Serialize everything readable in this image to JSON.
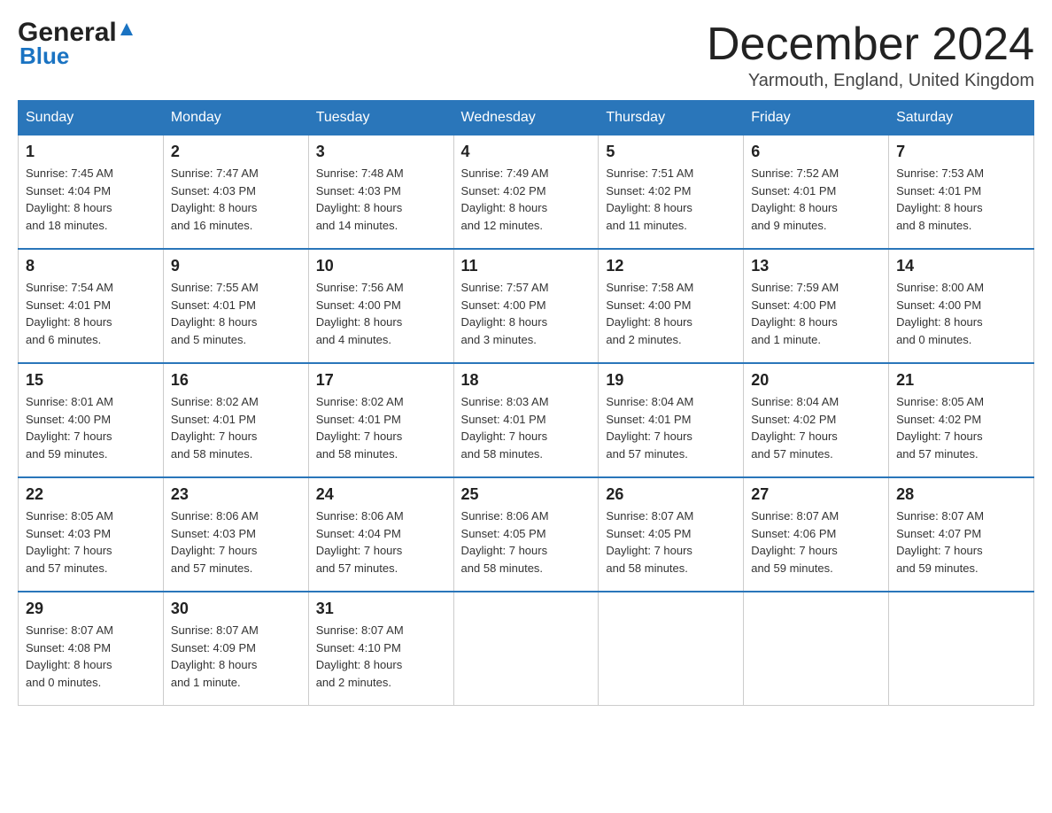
{
  "header": {
    "logo_general": "General",
    "logo_blue": "Blue",
    "month_title": "December 2024",
    "subtitle": "Yarmouth, England, United Kingdom"
  },
  "days_of_week": [
    "Sunday",
    "Monday",
    "Tuesday",
    "Wednesday",
    "Thursday",
    "Friday",
    "Saturday"
  ],
  "weeks": [
    [
      {
        "day": "1",
        "sunrise": "7:45 AM",
        "sunset": "4:04 PM",
        "daylight": "8 hours and 18 minutes."
      },
      {
        "day": "2",
        "sunrise": "7:47 AM",
        "sunset": "4:03 PM",
        "daylight": "8 hours and 16 minutes."
      },
      {
        "day": "3",
        "sunrise": "7:48 AM",
        "sunset": "4:03 PM",
        "daylight": "8 hours and 14 minutes."
      },
      {
        "day": "4",
        "sunrise": "7:49 AM",
        "sunset": "4:02 PM",
        "daylight": "8 hours and 12 minutes."
      },
      {
        "day": "5",
        "sunrise": "7:51 AM",
        "sunset": "4:02 PM",
        "daylight": "8 hours and 11 minutes."
      },
      {
        "day": "6",
        "sunrise": "7:52 AM",
        "sunset": "4:01 PM",
        "daylight": "8 hours and 9 minutes."
      },
      {
        "day": "7",
        "sunrise": "7:53 AM",
        "sunset": "4:01 PM",
        "daylight": "8 hours and 8 minutes."
      }
    ],
    [
      {
        "day": "8",
        "sunrise": "7:54 AM",
        "sunset": "4:01 PM",
        "daylight": "8 hours and 6 minutes."
      },
      {
        "day": "9",
        "sunrise": "7:55 AM",
        "sunset": "4:01 PM",
        "daylight": "8 hours and 5 minutes."
      },
      {
        "day": "10",
        "sunrise": "7:56 AM",
        "sunset": "4:00 PM",
        "daylight": "8 hours and 4 minutes."
      },
      {
        "day": "11",
        "sunrise": "7:57 AM",
        "sunset": "4:00 PM",
        "daylight": "8 hours and 3 minutes."
      },
      {
        "day": "12",
        "sunrise": "7:58 AM",
        "sunset": "4:00 PM",
        "daylight": "8 hours and 2 minutes."
      },
      {
        "day": "13",
        "sunrise": "7:59 AM",
        "sunset": "4:00 PM",
        "daylight": "8 hours and 1 minute."
      },
      {
        "day": "14",
        "sunrise": "8:00 AM",
        "sunset": "4:00 PM",
        "daylight": "8 hours and 0 minutes."
      }
    ],
    [
      {
        "day": "15",
        "sunrise": "8:01 AM",
        "sunset": "4:00 PM",
        "daylight": "7 hours and 59 minutes."
      },
      {
        "day": "16",
        "sunrise": "8:02 AM",
        "sunset": "4:01 PM",
        "daylight": "7 hours and 58 minutes."
      },
      {
        "day": "17",
        "sunrise": "8:02 AM",
        "sunset": "4:01 PM",
        "daylight": "7 hours and 58 minutes."
      },
      {
        "day": "18",
        "sunrise": "8:03 AM",
        "sunset": "4:01 PM",
        "daylight": "7 hours and 58 minutes."
      },
      {
        "day": "19",
        "sunrise": "8:04 AM",
        "sunset": "4:01 PM",
        "daylight": "7 hours and 57 minutes."
      },
      {
        "day": "20",
        "sunrise": "8:04 AM",
        "sunset": "4:02 PM",
        "daylight": "7 hours and 57 minutes."
      },
      {
        "day": "21",
        "sunrise": "8:05 AM",
        "sunset": "4:02 PM",
        "daylight": "7 hours and 57 minutes."
      }
    ],
    [
      {
        "day": "22",
        "sunrise": "8:05 AM",
        "sunset": "4:03 PM",
        "daylight": "7 hours and 57 minutes."
      },
      {
        "day": "23",
        "sunrise": "8:06 AM",
        "sunset": "4:03 PM",
        "daylight": "7 hours and 57 minutes."
      },
      {
        "day": "24",
        "sunrise": "8:06 AM",
        "sunset": "4:04 PM",
        "daylight": "7 hours and 57 minutes."
      },
      {
        "day": "25",
        "sunrise": "8:06 AM",
        "sunset": "4:05 PM",
        "daylight": "7 hours and 58 minutes."
      },
      {
        "day": "26",
        "sunrise": "8:07 AM",
        "sunset": "4:05 PM",
        "daylight": "7 hours and 58 minutes."
      },
      {
        "day": "27",
        "sunrise": "8:07 AM",
        "sunset": "4:06 PM",
        "daylight": "7 hours and 59 minutes."
      },
      {
        "day": "28",
        "sunrise": "8:07 AM",
        "sunset": "4:07 PM",
        "daylight": "7 hours and 59 minutes."
      }
    ],
    [
      {
        "day": "29",
        "sunrise": "8:07 AM",
        "sunset": "4:08 PM",
        "daylight": "8 hours and 0 minutes."
      },
      {
        "day": "30",
        "sunrise": "8:07 AM",
        "sunset": "4:09 PM",
        "daylight": "8 hours and 1 minute."
      },
      {
        "day": "31",
        "sunrise": "8:07 AM",
        "sunset": "4:10 PM",
        "daylight": "8 hours and 2 minutes."
      },
      null,
      null,
      null,
      null
    ]
  ],
  "labels": {
    "sunrise": "Sunrise:",
    "sunset": "Sunset:",
    "daylight": "Daylight:"
  }
}
